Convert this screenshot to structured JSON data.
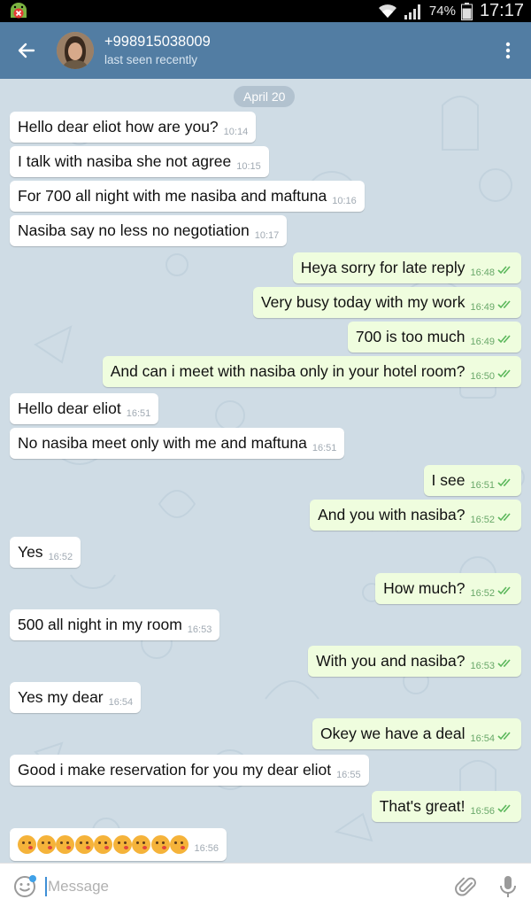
{
  "status_bar": {
    "battery_percent": "74%",
    "time": "17:17",
    "signal_icon": "signal-bars-icon",
    "wifi_icon": "wifi-icon",
    "notification_icon": "android-warning-icon"
  },
  "header": {
    "contact_name": "+998915038009",
    "status": "last seen recently",
    "back_icon": "arrow-back-icon",
    "menu_icon": "more-vert-icon"
  },
  "chat": {
    "date_separator": "April 20",
    "messages": [
      {
        "direction": "in",
        "text": "Hello dear eliot how are you?",
        "time": "10:14"
      },
      {
        "direction": "in",
        "text": "I talk with nasiba she not agree",
        "time": "10:15"
      },
      {
        "direction": "in",
        "text": "For 700 all night with me nasiba and maftuna",
        "time": "10:16"
      },
      {
        "direction": "in",
        "text": "Nasiba say no less no negotiation",
        "time": "10:17"
      },
      {
        "direction": "out",
        "text": "Heya sorry for late reply",
        "time": "16:48",
        "read": true
      },
      {
        "direction": "out",
        "text": "Very busy today with my work",
        "time": "16:49",
        "read": true
      },
      {
        "direction": "out",
        "text": "700 is too much",
        "time": "16:49",
        "read": true
      },
      {
        "direction": "out",
        "text": "And can i meet with nasiba only in your hotel room?",
        "time": "16:50",
        "read": true
      },
      {
        "direction": "in",
        "text": "Hello dear eliot",
        "time": "16:51"
      },
      {
        "direction": "in",
        "text": "No nasiba meet only with me and maftuna",
        "time": "16:51"
      },
      {
        "direction": "out",
        "text": "I see",
        "time": "16:51",
        "read": true
      },
      {
        "direction": "out",
        "text": "And you with nasiba?",
        "time": "16:52",
        "read": true
      },
      {
        "direction": "in",
        "text": "Yes",
        "time": "16:52"
      },
      {
        "direction": "out",
        "text": "How much?",
        "time": "16:52",
        "read": true
      },
      {
        "direction": "in",
        "text": "500 all night in my room",
        "time": "16:53"
      },
      {
        "direction": "out",
        "text": "With you and nasiba?",
        "time": "16:53",
        "read": true
      },
      {
        "direction": "in",
        "text": "Yes my dear",
        "time": "16:54"
      },
      {
        "direction": "out",
        "text": "Okey we have a deal",
        "time": "16:54",
        "read": true
      },
      {
        "direction": "in",
        "text": "Good i make reservation for you my dear eliot",
        "time": "16:55"
      },
      {
        "direction": "out",
        "text": "That's great!",
        "time": "16:56",
        "read": true
      },
      {
        "direction": "in",
        "text": "",
        "emoji": "face-blowing-a-kiss",
        "emoji_count": 9,
        "time": "16:56"
      }
    ]
  },
  "input_bar": {
    "placeholder": "Message",
    "emoji_icon": "smile-icon",
    "attach_icon": "paperclip-icon",
    "mic_icon": "microphone-icon"
  },
  "colors": {
    "header_bg": "#527da3",
    "chat_bg": "#cfdce5",
    "incoming_bubble": "#ffffff",
    "outgoing_bubble": "#effdde",
    "read_ticks": "#5cb85c"
  }
}
